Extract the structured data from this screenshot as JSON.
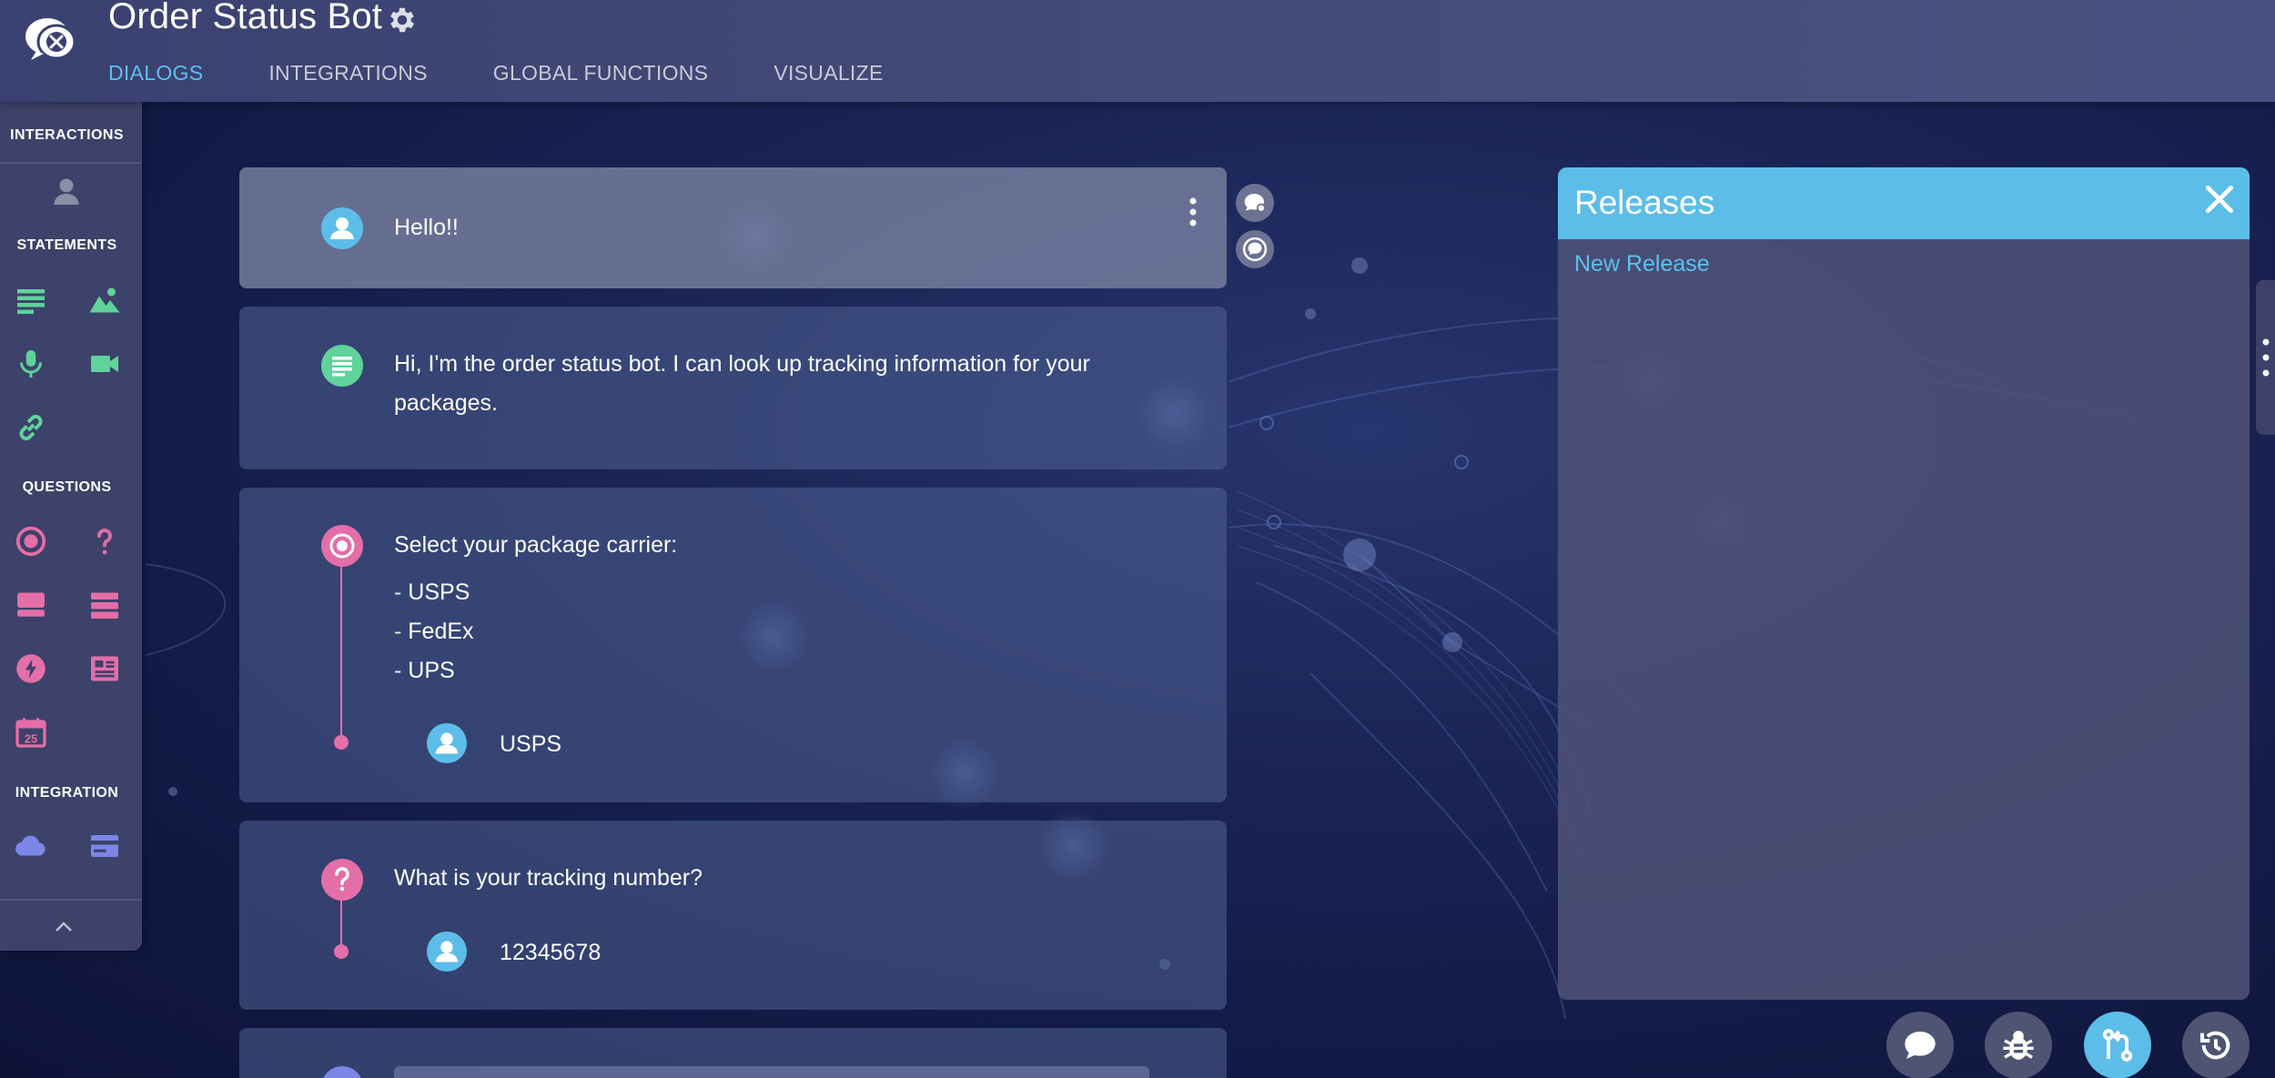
{
  "header": {
    "title": "Order Status Bot",
    "tabs": [
      {
        "label": "DIALOGS",
        "active": true
      },
      {
        "label": "INTEGRATIONS",
        "active": false
      },
      {
        "label": "GLOBAL FUNCTIONS",
        "active": false
      },
      {
        "label": "VISUALIZE",
        "active": false
      }
    ]
  },
  "toolbar": {
    "sections": {
      "interactions": "INTERACTIONS",
      "statements": "STATEMENTS",
      "questions": "QUESTIONS",
      "integration": "INTEGRATION"
    },
    "calendar_day": "25",
    "icons": {
      "interactions": [
        "user-icon"
      ],
      "statements": [
        "text-icon",
        "image-icon",
        "audio-icon",
        "video-icon",
        "link-icon"
      ],
      "questions": [
        "radio-choice-icon",
        "question-mark-icon",
        "card-icon",
        "list-icon",
        "lightning-icon",
        "form-icon",
        "calendar-icon"
      ],
      "integration": [
        "cloud-icon",
        "payment-card-icon"
      ]
    }
  },
  "dialog": {
    "items": [
      {
        "type": "user",
        "text": "Hello!!"
      },
      {
        "type": "statement",
        "lines": [
          "Hi, I'm the order status bot. I can look up tracking information for your",
          "packages."
        ]
      },
      {
        "type": "choice-question",
        "prompt": "Select your package carrier:",
        "options": [
          "USPS",
          "FedEx",
          "UPS"
        ],
        "reply": "USPS"
      },
      {
        "type": "question",
        "prompt": "What is your tracking number?",
        "reply": "12345678"
      }
    ]
  },
  "releases": {
    "title": "Releases",
    "link": "New Release"
  },
  "colors": {
    "accent_blue": "#5cbde9",
    "statement_green": "#5fd39a",
    "question_pink": "#e46ea8",
    "integration_purple": "#7b86e6"
  },
  "fabs": [
    "chat-icon",
    "bug-icon",
    "merge-icon",
    "history-icon"
  ]
}
